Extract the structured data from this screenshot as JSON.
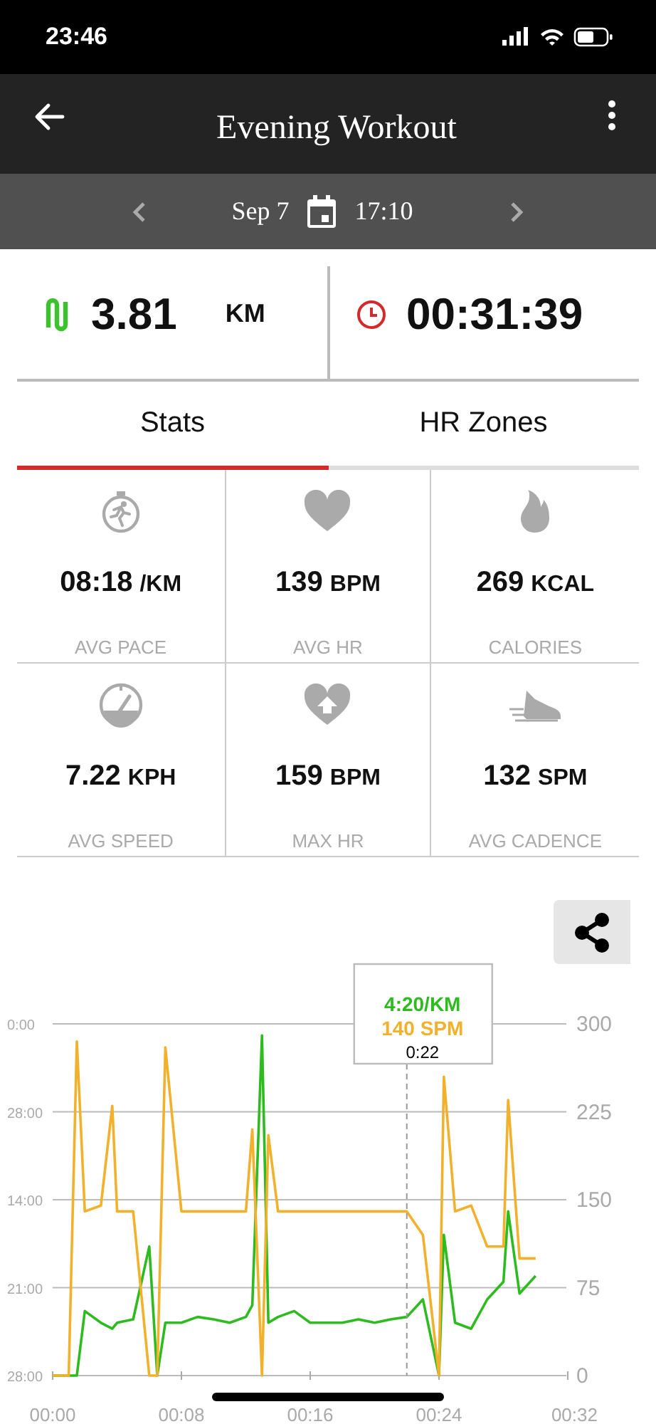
{
  "status_bar": {
    "time": "23:46"
  },
  "header": {
    "title": "Evening Workout"
  },
  "date_bar": {
    "date": "Sep 7",
    "time": "17:10"
  },
  "summary": [
    {
      "kind": "distance",
      "value": "3.81",
      "unit": "KM"
    },
    {
      "kind": "duration",
      "value": "00:31:39"
    }
  ],
  "tabs": [
    {
      "label": "Stats",
      "selected": true
    },
    {
      "label": "HR Zones",
      "selected": false
    }
  ],
  "stats": [
    {
      "kind": "stopwatch",
      "value": "08:18",
      "unit": "/KM",
      "label": "AVG PACE"
    },
    {
      "kind": "heart",
      "value": "139",
      "unit": "BPM",
      "label": "AVG HR"
    },
    {
      "kind": "flame",
      "value": "269",
      "unit": "KCAL",
      "label": "CALORIES"
    },
    {
      "kind": "gauge",
      "value": "7.22",
      "unit": "KPH",
      "label": "AVG SPEED"
    },
    {
      "kind": "heart-up",
      "value": "159",
      "unit": "BPM",
      "label": "MAX HR"
    },
    {
      "kind": "shoe",
      "value": "132",
      "unit": "SPM",
      "label": "AVG CADENCE"
    }
  ],
  "chart": {
    "tooltip": {
      "pace": "4:20/KM",
      "cadence": "140 SPM"
    },
    "left_axis_labels": [
      "0:00",
      "28:00",
      "14:00",
      "21:00",
      "28:00"
    ],
    "chart_data": {
      "type": "line",
      "x": [
        0,
        1,
        1.5,
        2,
        3,
        3.7,
        4,
        5,
        6,
        6.5,
        7,
        8,
        9,
        10,
        11,
        12,
        12.4,
        13,
        13.4,
        14,
        15,
        16,
        17,
        18,
        19,
        20,
        21,
        22,
        23,
        24,
        24.3,
        25,
        26,
        27,
        28,
        28.3,
        29,
        30
      ],
      "series": [
        {
          "color": "#2dbb1f",
          "values": [
            0,
            0,
            0,
            55,
            45,
            40,
            45,
            48,
            110,
            0,
            45,
            45,
            50,
            48,
            45,
            50,
            60,
            290,
            45,
            50,
            55,
            45,
            45,
            45,
            48,
            45,
            48,
            50,
            65,
            0,
            120,
            45,
            40,
            65,
            80,
            140,
            70,
            85
          ]
        },
        {
          "color": "#f2b12c",
          "values": [
            0,
            0,
            285,
            140,
            145,
            230,
            140,
            140,
            0,
            0,
            280,
            140,
            140,
            140,
            140,
            140,
            210,
            0,
            205,
            140,
            140,
            140,
            140,
            140,
            140,
            140,
            140,
            140,
            120,
            0,
            255,
            140,
            145,
            110,
            110,
            235,
            100,
            100
          ]
        }
      ],
      "xlim": [
        0,
        32
      ],
      "ylim": [
        0,
        300
      ],
      "xticks": [
        {
          "value": 0,
          "label": "00:00"
        },
        {
          "value": 8,
          "label": "00:08"
        },
        {
          "value": 16,
          "label": "00:16"
        },
        {
          "value": 24,
          "label": "00:24"
        },
        {
          "value": 32,
          "label": "00:32"
        }
      ],
      "yticks": [
        0,
        75,
        150,
        225,
        300
      ],
      "grid": true,
      "ref_lines": [
        {
          "axis": "x",
          "value": 22
        }
      ],
      "annotations": [
        "0:22"
      ]
    }
  }
}
